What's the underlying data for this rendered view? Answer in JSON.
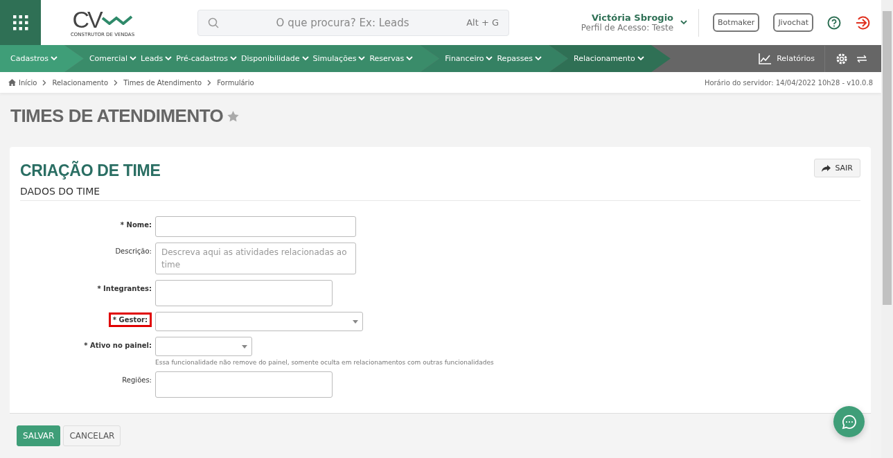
{
  "header": {
    "logo": {
      "mark": "CV",
      "tagline": "CONSTRUTOR DE VENDAS"
    },
    "search": {
      "placeholder": "O que procura? Ex: Leads",
      "shortcut": "Alt + G"
    },
    "user": {
      "name": "Victória Sbrogio",
      "profile": "Perfil de Acesso: Teste"
    },
    "buttons": [
      "Botmaker",
      "Jivochat"
    ]
  },
  "nav": {
    "groups": [
      {
        "color": "#3f9e78",
        "items": [
          "Cadastros"
        ]
      },
      {
        "color": "#3a8c6a",
        "items": [
          "Comercial",
          "Leads",
          "Pré-cadastros",
          "Disponibilidade",
          "Simulações",
          "Reservas"
        ]
      },
      {
        "color": "#358163",
        "items": [
          "Financeiro",
          "Repasses"
        ]
      },
      {
        "color": "#2f7055",
        "items": [
          "Relacionamento"
        ]
      }
    ],
    "reports": "Relatórios"
  },
  "breadcrumb": [
    "Início",
    "Relacionamento",
    "Times de Atendimento",
    "Formulário"
  ],
  "server_time": "Horário do servidor: 14/04/2022 10h28 - v10.0.8",
  "page_title": "TIMES DE ATENDIMENTO",
  "card": {
    "title": "CRIAÇÃO DE TIME",
    "exit_button": "SAIR",
    "section": "DADOS DO TIME",
    "fields": [
      {
        "kind": "text",
        "label": "* Nome:",
        "bold": true,
        "highlighted": false
      },
      {
        "kind": "textarea",
        "label": "Descrição:",
        "bold": false,
        "highlighted": false,
        "placeholder": "Descreva aqui as atividades relacionadas ao time"
      },
      {
        "kind": "box",
        "label": "* Integrantes:",
        "bold": true,
        "highlighted": false
      },
      {
        "kind": "select",
        "label": "* Gestor:",
        "bold": true,
        "highlighted": true
      },
      {
        "kind": "select_small",
        "label": "* Ativo no painel:",
        "bold": true,
        "highlighted": false,
        "help": "Essa funcionalidade não remove do painel, somente oculta em relacionamentos com outras funcionalidades"
      },
      {
        "kind": "box",
        "label": "Regiões:",
        "bold": false,
        "highlighted": false
      }
    ],
    "actions": [
      {
        "label": "SALVAR",
        "primary": true
      },
      {
        "label": "CANCELAR",
        "primary": false
      }
    ]
  }
}
